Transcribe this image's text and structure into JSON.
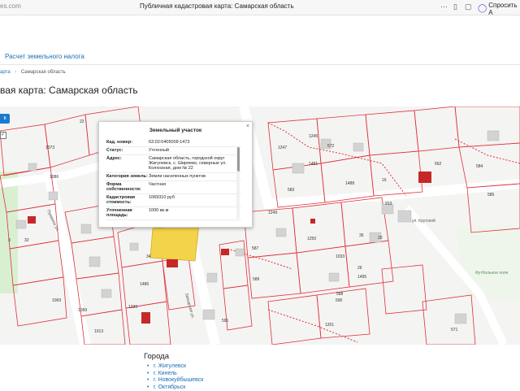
{
  "browser": {
    "url_fragment": "es.com",
    "tab_title": "Публичная кадастровая карта: Самарская область",
    "ask_label": "Спросить А"
  },
  "nav": {
    "calc_link": "Расчет земельного налога"
  },
  "breadcrumb": {
    "item1": "арта",
    "item2": "Самарская область"
  },
  "page_title": "вая карта: Самарская область",
  "map": {
    "layer_button_label": "к",
    "parcel_numbers": [
      "1073",
      "1086",
      "22",
      "1247",
      "572",
      "1481",
      "1488",
      "583",
      "1249",
      "913",
      "587",
      "589",
      "1250",
      "1033",
      "1239",
      "1486",
      "1089",
      "1069",
      "1013",
      "590",
      "591",
      "1201",
      "583",
      "571",
      "16",
      "20",
      "36",
      "26",
      "28",
      "30",
      "32",
      "34",
      "593",
      "588",
      "586",
      "562",
      "584",
      "585",
      "1495",
      "1245"
    ],
    "street_labels": [
      "ул. Крутской",
      "Пушкина ул.",
      "Заводская ул.",
      "Футбольное поле"
    ]
  },
  "popup": {
    "title": "Земельный участок",
    "rows": [
      {
        "k": "Кад. номер:",
        "v": "63:02:0405009:1473"
      },
      {
        "k": "Статус:",
        "v": "Учтенный"
      },
      {
        "k": "Адрес:",
        "v": "Самарская область, городской округ Жигулевск, с. Ширяево, северные ул. Колхозная, дом № 22"
      },
      {
        "k": "Категория земель:",
        "v": "Земли населенных пунктов"
      },
      {
        "k": "Форма собственности:",
        "v": "Частная"
      },
      {
        "k": "Кадастровая стоимость:",
        "v": "1069310 руб"
      },
      {
        "k": "Уточненная площадь:",
        "v": "1000 кв.м"
      }
    ]
  },
  "cities": {
    "heading": "Города",
    "items": [
      "г. Жигулевск",
      "г. Кинель",
      "г. Новокуйбышевск",
      "г. Октябрьск"
    ]
  },
  "colors": {
    "accent": "#1a6fb6",
    "parcel_line": "#e0303a",
    "highlight": "#f3d34a",
    "building_red": "#c62828"
  }
}
